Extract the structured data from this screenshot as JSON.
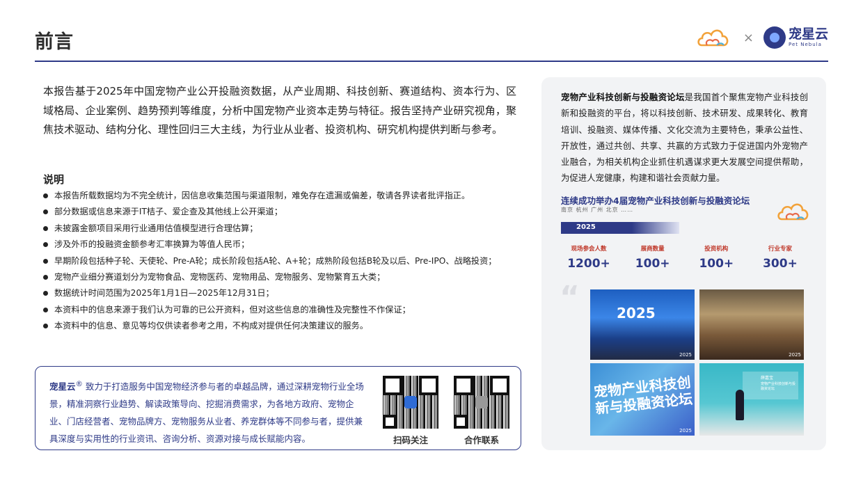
{
  "header": {
    "title": "前言",
    "times": "×",
    "brand_name": "宠星云",
    "brand_sub": "Pet Nebula"
  },
  "intro": "本报告基于2025年中国宠物产业公开投融资数据，从产业周期、科技创新、赛道结构、资本行为、区域格局、企业案例、趋势预判等维度，分析中国宠物产业资本走势与特征。报告坚持产业研究视角，聚焦技术驱动、结构分化、理性回归三大主线，为行业从业者、投资机构、研究机构提供判断与参考。",
  "notes": {
    "heading": "说明",
    "items": [
      "本报告所载数据均为不完全统计，因信息收集范围与渠道限制，难免存在遗漏或偏差，敬请各界读者批评指正。",
      "部分数据或信息来源于IT桔子、爱企查及其他线上公开渠道；",
      "未披露金额项目采用行业通用估值模型进行合理估算；",
      "涉及外币的投融资金额参考汇率换算为等值人民币；",
      "早期阶段包括种子轮、天使轮、Pre-A轮；成长阶段包括A轮、A+轮；成熟阶段包括B轮及以后、Pre-IPO、战略投资；",
      "宠物产业细分赛道划分为宠物食品、宠物医药、宠物用品、宠物服务、宠物繁育五大类；",
      "数据统计时间范围为2025年1月1日—2025年12月31日；",
      "本资料中的信息来源于我们认为可靠的已公开资料，但对这些信息的准确性及完整性不作保证；",
      "本资料中的信息、意见等均仅供读者参考之用，不构成对提供任何决策建议的服务。"
    ]
  },
  "brand_box": {
    "name": "宠星云",
    "reg": "®",
    "desc": " 致力于打造服务中国宠物经济参与者的卓越品牌，通过深耕宠物行业全场景，精准洞察行业趋势、解读政策导向、挖掘消费需求，为各地方政府、宠物企业、门店经营者、宠物品牌方、宠物服务从业者、养宠群体等不同参与者，提供兼具深度与实用性的行业资讯、咨询分析、资源对接与成长赋能内容。",
    "qr_follow_label": "扫码关注",
    "qr_contact_label": "合作联系"
  },
  "panel": {
    "forum_name": "宠物产业科技创新与投融资论坛",
    "forum_desc": "是我国首个聚焦宠物产业科技创新和投融资的平台，将以科技创新、技术研发、成果转化、教育培训、投融资、媒体传播、文化交流为主要特色，秉承公益性、开放性，通过共创、共享、共赢的方式致力于促进国内外宠物产业融合，为相关机构企业抓住机遇谋求更大发展空间提供帮助，为促进人宠健康，构建和谐社会贡献力量。",
    "forum_title": "连续成功举办4届宠物产业科技创新与投融资论坛",
    "cities": "南京  杭州  广州  北京  ……",
    "year": "2025",
    "stats": [
      {
        "label": "现场参会人数",
        "value": "1200+"
      },
      {
        "label": "展商数量",
        "value": "100+"
      },
      {
        "label": "投资机构",
        "value": "100+"
      },
      {
        "label": "行业专家",
        "value": "300+"
      }
    ],
    "quote": "“",
    "photos": {
      "p1_year": "2025",
      "p1_tag": "2025",
      "p2_tag": "2025",
      "p3_text": "宠物产业科技创新与投融资论坛",
      "p3_tag": "2025",
      "p4_name": "薛嘉宝",
      "p4_role": "宠物产业科技创新与投融资论坛"
    }
  },
  "colors": {
    "brand_navy": "#2e3a87",
    "stat_label_red": "#c0392b",
    "panel_bg": "#f2f3f5"
  }
}
